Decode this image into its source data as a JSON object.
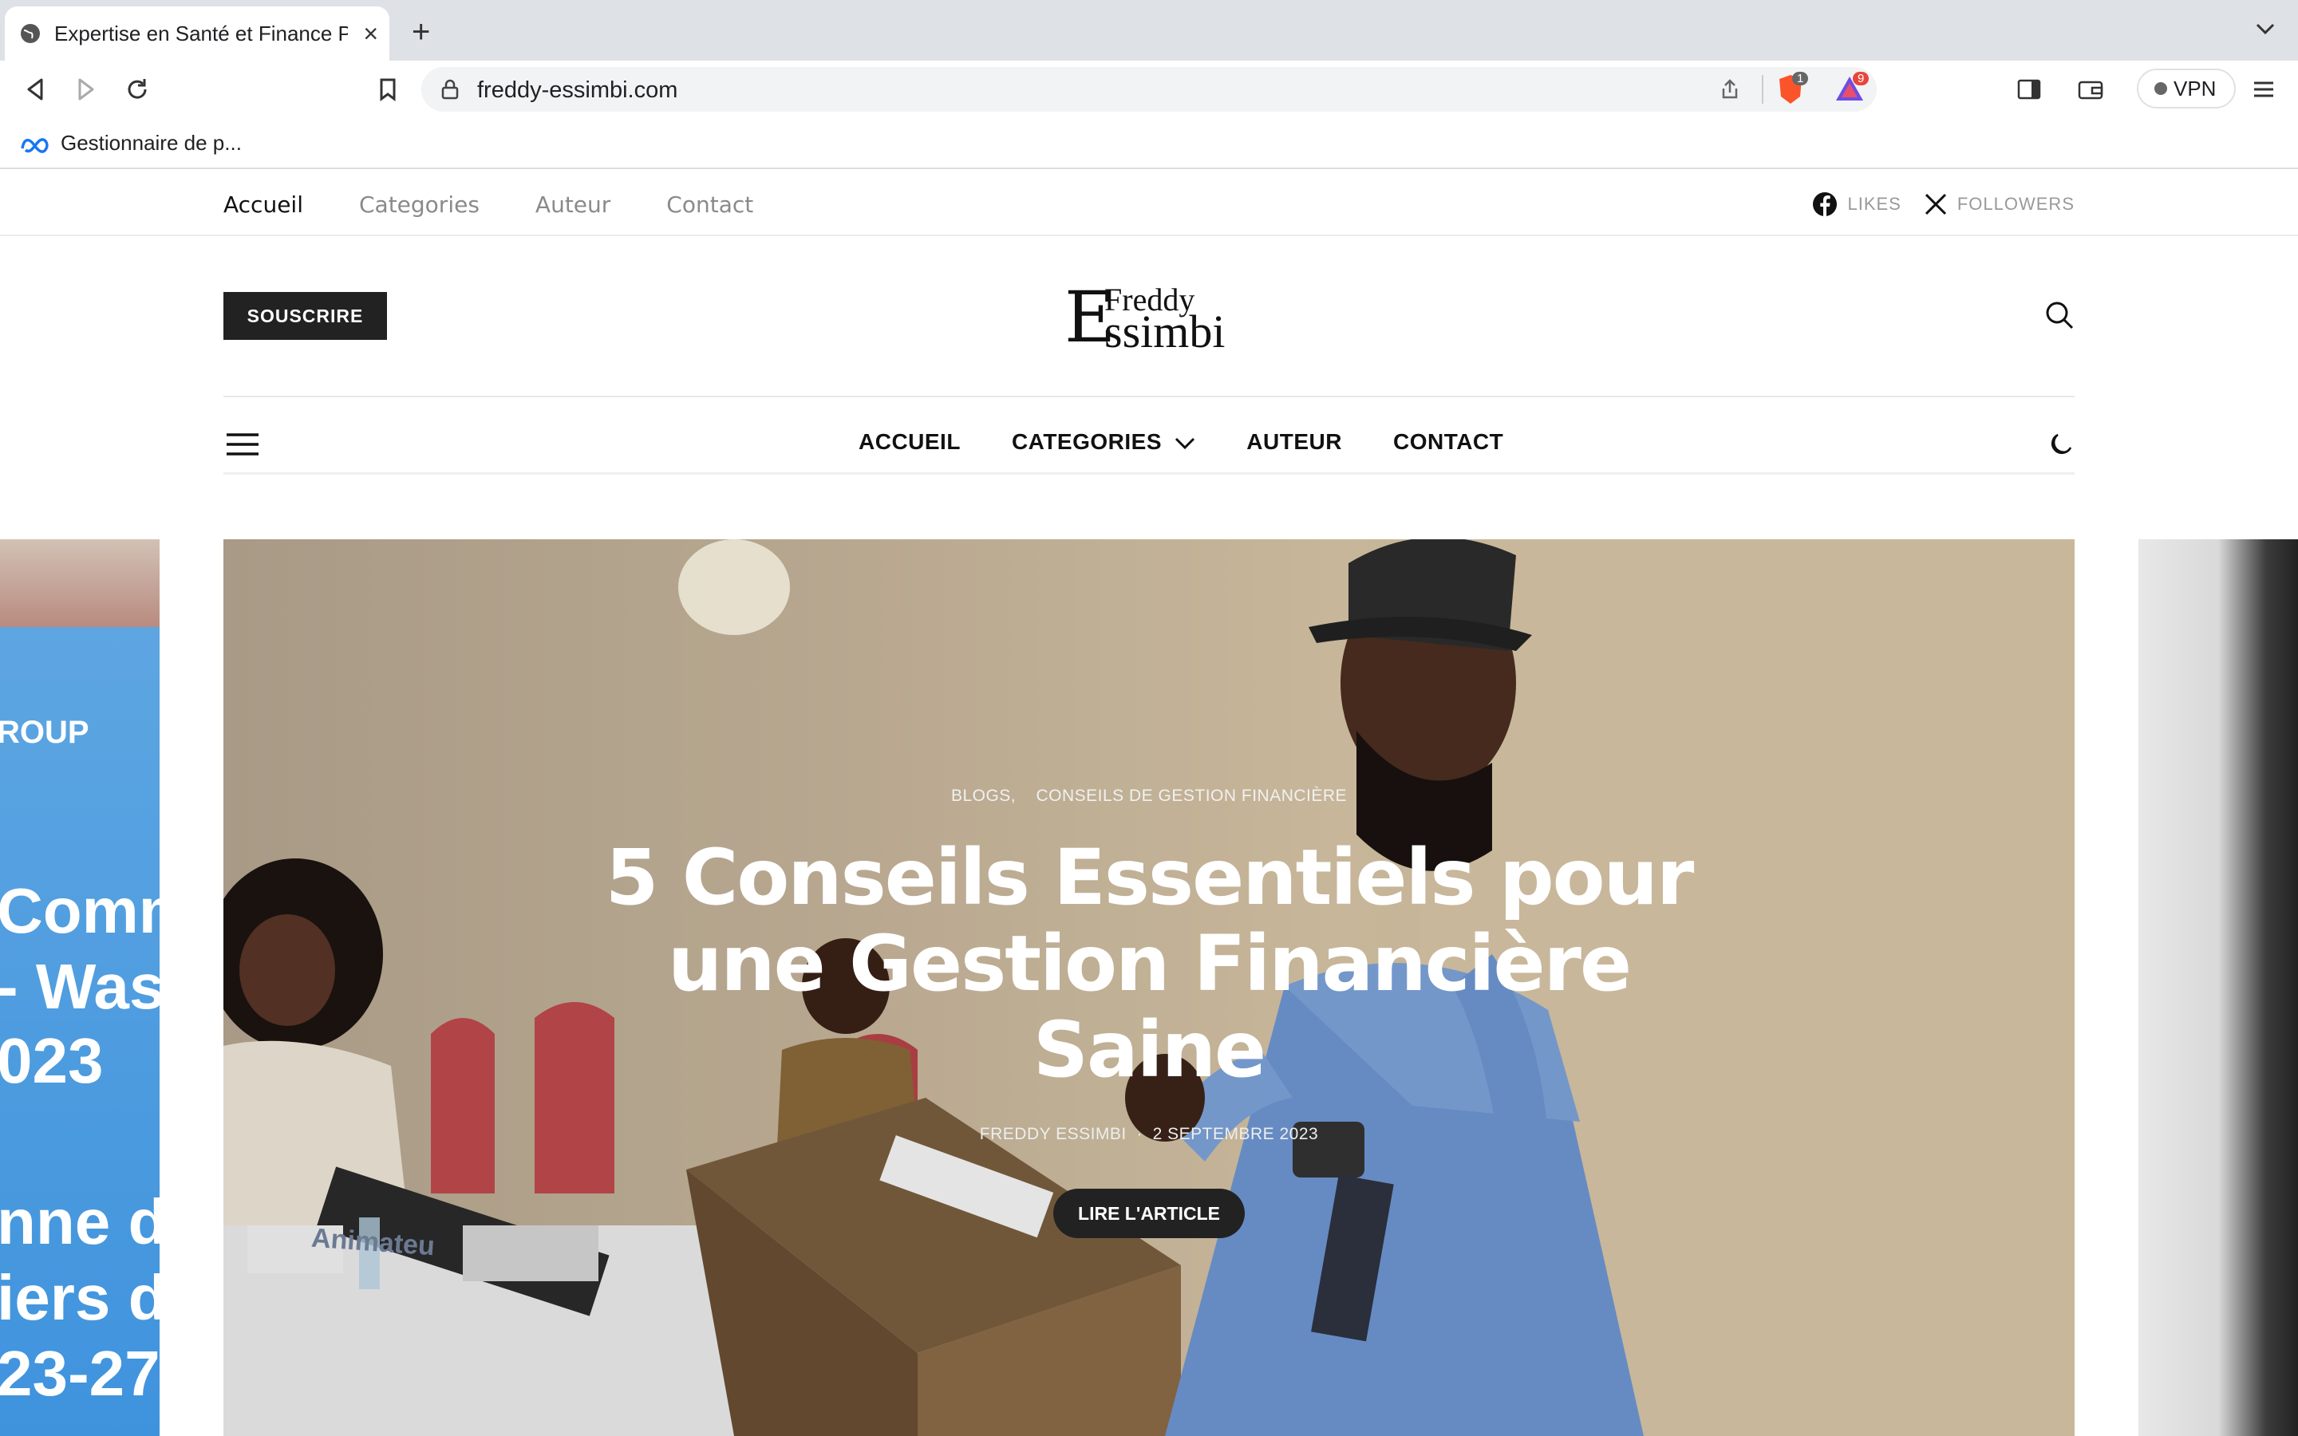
{
  "browser": {
    "tab_title": "Expertise en Santé et Finance P",
    "url": "freddy-essimbi.com",
    "bookmark_label": "Gestionnaire de p...",
    "vpn_label": "VPN",
    "brave_badge": "1",
    "alert_badge": "9"
  },
  "topbar": {
    "nav": [
      "Accueil",
      "Categories",
      "Auteur",
      "Contact"
    ],
    "likes_label": "LIKES",
    "followers_label": "FOLLOWERS"
  },
  "header": {
    "subscribe_label": "SOUSCRIRE",
    "logo_big": "E",
    "logo_top": "Freddy",
    "logo_bottom": "ssimbi"
  },
  "main_nav": [
    "ACCUEIL",
    "CATEGORIES",
    "AUTEUR",
    "CONTACT"
  ],
  "hero": {
    "categories": [
      "BLOGS,",
      "CONSEILS DE GESTION FINANCIÈRE"
    ],
    "title_lines": [
      "5 Conseils Essentiels pour",
      "une Gestion Financière",
      "Saine"
    ],
    "author": "FREDDY ESSIMBI",
    "date": "2 SEPTEMBRE 2023",
    "cta": "LIRE L'ARTICLE",
    "podium_label": "Animateu"
  },
  "side_left_text": [
    "ROUP",
    "Comm",
    "- Was",
    "023",
    "nne d",
    "iers d",
    "23-27"
  ],
  "colors": {
    "accent": "#222222",
    "facebook": "#111111",
    "brave": "#fb542b"
  }
}
